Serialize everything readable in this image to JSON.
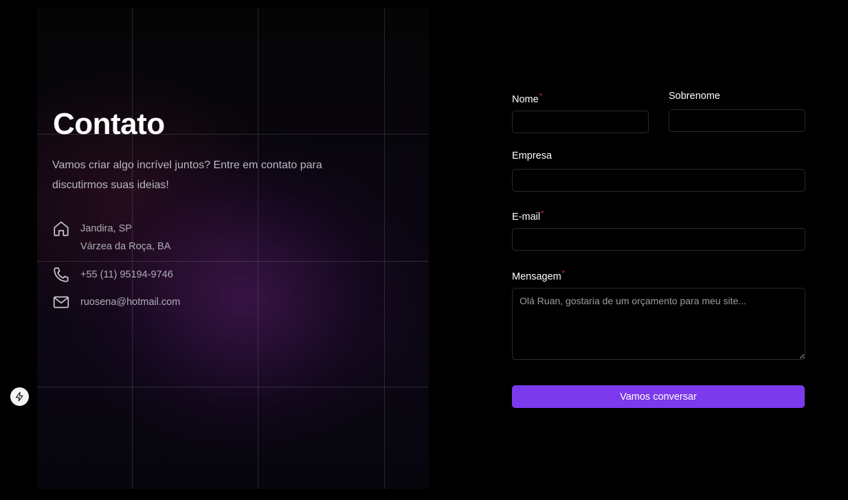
{
  "contact": {
    "title": "Contato",
    "subtitle": "Vamos criar algo incrível juntos? Entre em contato para discutirmos suas ideias!",
    "address_line1": "Jandira, SP",
    "address_line2": "Várzea da Roça, BA",
    "phone": "+55 (11) 95194-9746",
    "email": "ruosena@hotmail.com",
    "icons": {
      "address": "home-icon",
      "phone": "phone-icon",
      "email": "mail-icon"
    }
  },
  "form": {
    "first_name": {
      "label": "Nome",
      "required_mark": "*",
      "value": "",
      "placeholder": ""
    },
    "last_name": {
      "label": "Sobrenome",
      "value": "",
      "placeholder": ""
    },
    "company": {
      "label": "Empresa",
      "value": "",
      "placeholder": ""
    },
    "email": {
      "label": "E-mail",
      "required_mark": "*",
      "value": "",
      "placeholder": ""
    },
    "message": {
      "label": "Mensagem",
      "required_mark": "*",
      "value": "",
      "placeholder": "Olá Ruan, gostaria de um orçamento para meu site..."
    },
    "submit_label": "Vamos conversar"
  },
  "floating": {
    "icon": "lightning-bolt-icon"
  },
  "colors": {
    "accent": "#7c3aed",
    "required": "#d9353f",
    "background": "#000000"
  }
}
